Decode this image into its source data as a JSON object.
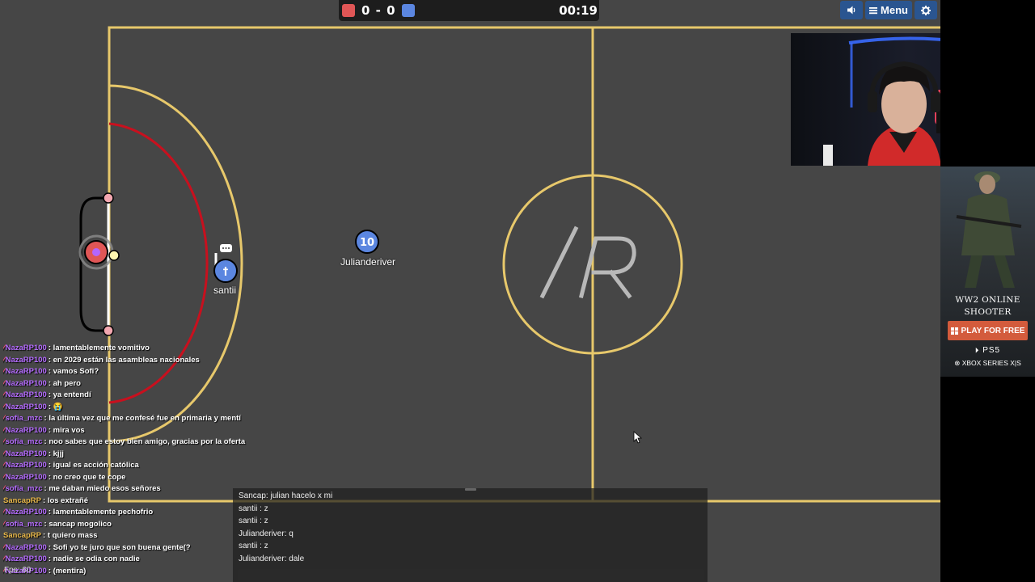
{
  "scoreboard": {
    "red_score": "0",
    "separator": "-",
    "blue_score": "0",
    "timer": "00:19",
    "red_color": "#e05656",
    "blue_color": "#5b86e0"
  },
  "toolbar": {
    "sound_icon": "speaker-icon",
    "menu_label": "Menu",
    "menu_icon": "hamburger-icon",
    "settings_icon": "gear-icon"
  },
  "field": {
    "center_logo": "/R",
    "line_color": "#e7c86b",
    "penalty_color": "#c8101e"
  },
  "players": [
    {
      "name": "Julianderiver",
      "number": "10",
      "team": "blue"
    },
    {
      "name": "santii",
      "number": "†",
      "team": "blue"
    }
  ],
  "twitch_chat": [
    {
      "user": "NazaRP100",
      "message": "lamentablemente vomitivo",
      "color": "#b56cff",
      "badge": true
    },
    {
      "user": "NazaRP100",
      "message": "en 2029 están las asambleas nacionales",
      "color": "#b56cff",
      "badge": true
    },
    {
      "user": "NazaRP100",
      "message": "vamos Sofi?",
      "color": "#b56cff",
      "badge": true
    },
    {
      "user": "NazaRP100",
      "message": "ah pero",
      "color": "#b56cff",
      "badge": true
    },
    {
      "user": "NazaRP100",
      "message": "ya entendí",
      "color": "#b56cff",
      "badge": true
    },
    {
      "user": "NazaRP100",
      "message": "😭",
      "color": "#b56cff",
      "badge": true
    },
    {
      "user": "sofia_mzc",
      "message": "la última vez que me confesé fue en primaria y mentí",
      "color": "#b56cff",
      "badge": true
    },
    {
      "user": "NazaRP100",
      "message": "mira vos",
      "color": "#b56cff",
      "badge": true
    },
    {
      "user": "sofia_mzc",
      "message": "noo sabes que estoy bien amigo, gracias por la oferta",
      "color": "#b56cff",
      "badge": true
    },
    {
      "user": "NazaRP100",
      "message": "kjjj",
      "color": "#b56cff",
      "badge": true
    },
    {
      "user": "NazaRP100",
      "message": "igual es acción católica",
      "color": "#b56cff",
      "badge": true
    },
    {
      "user": "NazaRP100",
      "message": "no creo que te cope",
      "color": "#b56cff",
      "badge": true
    },
    {
      "user": "sofia_mzc",
      "message": "me daban miedo esos señores",
      "color": "#b56cff",
      "badge": true
    },
    {
      "user": "SancapRP",
      "message": "los extrañé",
      "color": "#e8b84a",
      "badge": false
    },
    {
      "user": "NazaRP100",
      "message": "lamentablemente pechofrio",
      "color": "#b56cff",
      "badge": true
    },
    {
      "user": "sofia_mzc",
      "message": "sancap mogolico",
      "color": "#b56cff",
      "badge": true
    },
    {
      "user": "SancapRP",
      "message": "t quiero mass",
      "color": "#e8b84a",
      "badge": false
    },
    {
      "user": "NazaRP100",
      "message": "Sofi yo te juro que son buena gente(?",
      "color": "#b56cff",
      "badge": true
    },
    {
      "user": "NazaRP100",
      "message": "nadie se odia con nadie",
      "color": "#b56cff",
      "badge": true
    },
    {
      "user": "NazaRP100",
      "message": "(mentira)",
      "color": "#b56cff",
      "badge": true
    }
  ],
  "fps_label": "Fps: 60",
  "game_chat": {
    "lines": [
      "Sancap: julian hacelo x mi",
      "santii : z",
      "santii : z",
      "Julianderiver: q",
      "santii : z",
      "Julianderiver: dale"
    ],
    "input_placeholder": ""
  },
  "ad": {
    "title_line1": "WW2 ONLINE",
    "title_line2": "SHOOTER",
    "cta": "PLAY FOR FREE",
    "platform1": "PS5",
    "platform2": "XBOX SERIES X|S"
  }
}
